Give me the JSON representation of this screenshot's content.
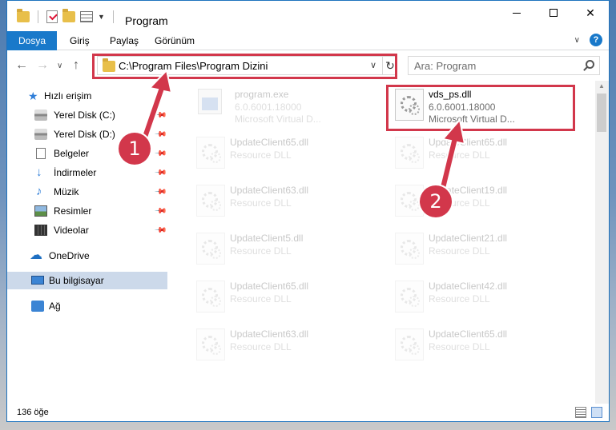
{
  "window": {
    "title": "Program",
    "controls": {
      "minimize": "–",
      "maximize": "□",
      "close": "✕"
    }
  },
  "ribbon": {
    "tabs": [
      "Dosya",
      "Giriş",
      "Paylaş",
      "Görünüm"
    ],
    "help": "?"
  },
  "nav": {
    "address": "C:\\Program Files\\Program Dizini",
    "search_placeholder": "Ara: Program"
  },
  "sidebar": {
    "items": [
      {
        "label": "Hızlı erişim",
        "icon": "star-icon",
        "pinned": false
      },
      {
        "label": "Yerel Disk (C:)",
        "icon": "disk-icon",
        "pinned": true
      },
      {
        "label": "Yerel Disk (D:)",
        "icon": "disk-icon",
        "pinned": true
      },
      {
        "label": "Belgeler",
        "icon": "document-icon",
        "pinned": true
      },
      {
        "label": "İndirmeler",
        "icon": "download-icon",
        "pinned": true
      },
      {
        "label": "Müzik",
        "icon": "music-icon",
        "pinned": true
      },
      {
        "label": "Resimler",
        "icon": "pictures-icon",
        "pinned": true
      },
      {
        "label": "Videolar",
        "icon": "videos-icon",
        "pinned": true
      },
      {
        "label": "OneDrive",
        "icon": "cloud-icon",
        "pinned": false
      },
      {
        "label": "Bu bilgisayar",
        "icon": "computer-icon",
        "pinned": false,
        "selected": true
      },
      {
        "label": "Ağ",
        "icon": "network-icon",
        "pinned": false
      }
    ]
  },
  "files": {
    "highlighted": {
      "name": "vds_ps.dll",
      "version": "6.0.6001.18000",
      "description": "Microsoft Virtual D..."
    },
    "program": {
      "name": "program.exe",
      "version": "6.0.6001.18000",
      "description": "Microsoft Virtual D..."
    },
    "left_column": [
      {
        "name": "UpdateClient65.dll",
        "type": "Resource DLL"
      },
      {
        "name": "UpdateClient63.dll",
        "type": "Resource DLL"
      },
      {
        "name": "UpdateClient5.dll",
        "type": "Resource DLL"
      },
      {
        "name": "UpdateClient65.dll",
        "type": "Resource DLL"
      },
      {
        "name": "UpdateClient63.dll",
        "type": "Resource DLL"
      }
    ],
    "right_column": [
      {
        "name": "UpdateClient65.dll",
        "type": "Resource DLL"
      },
      {
        "name": "UpdateClient19.dll",
        "type": "Resource DLL"
      },
      {
        "name": "UpdateClient21.dll",
        "type": "Resource DLL"
      },
      {
        "name": "UpdateClient42.dll",
        "type": "Resource DLL"
      },
      {
        "name": "UpdateClient65.dll",
        "type": "Resource DLL"
      }
    ]
  },
  "status": {
    "item_count": "136 öğe"
  },
  "annotations": {
    "step1": "1",
    "step2": "2",
    "color": "#d2374b"
  }
}
